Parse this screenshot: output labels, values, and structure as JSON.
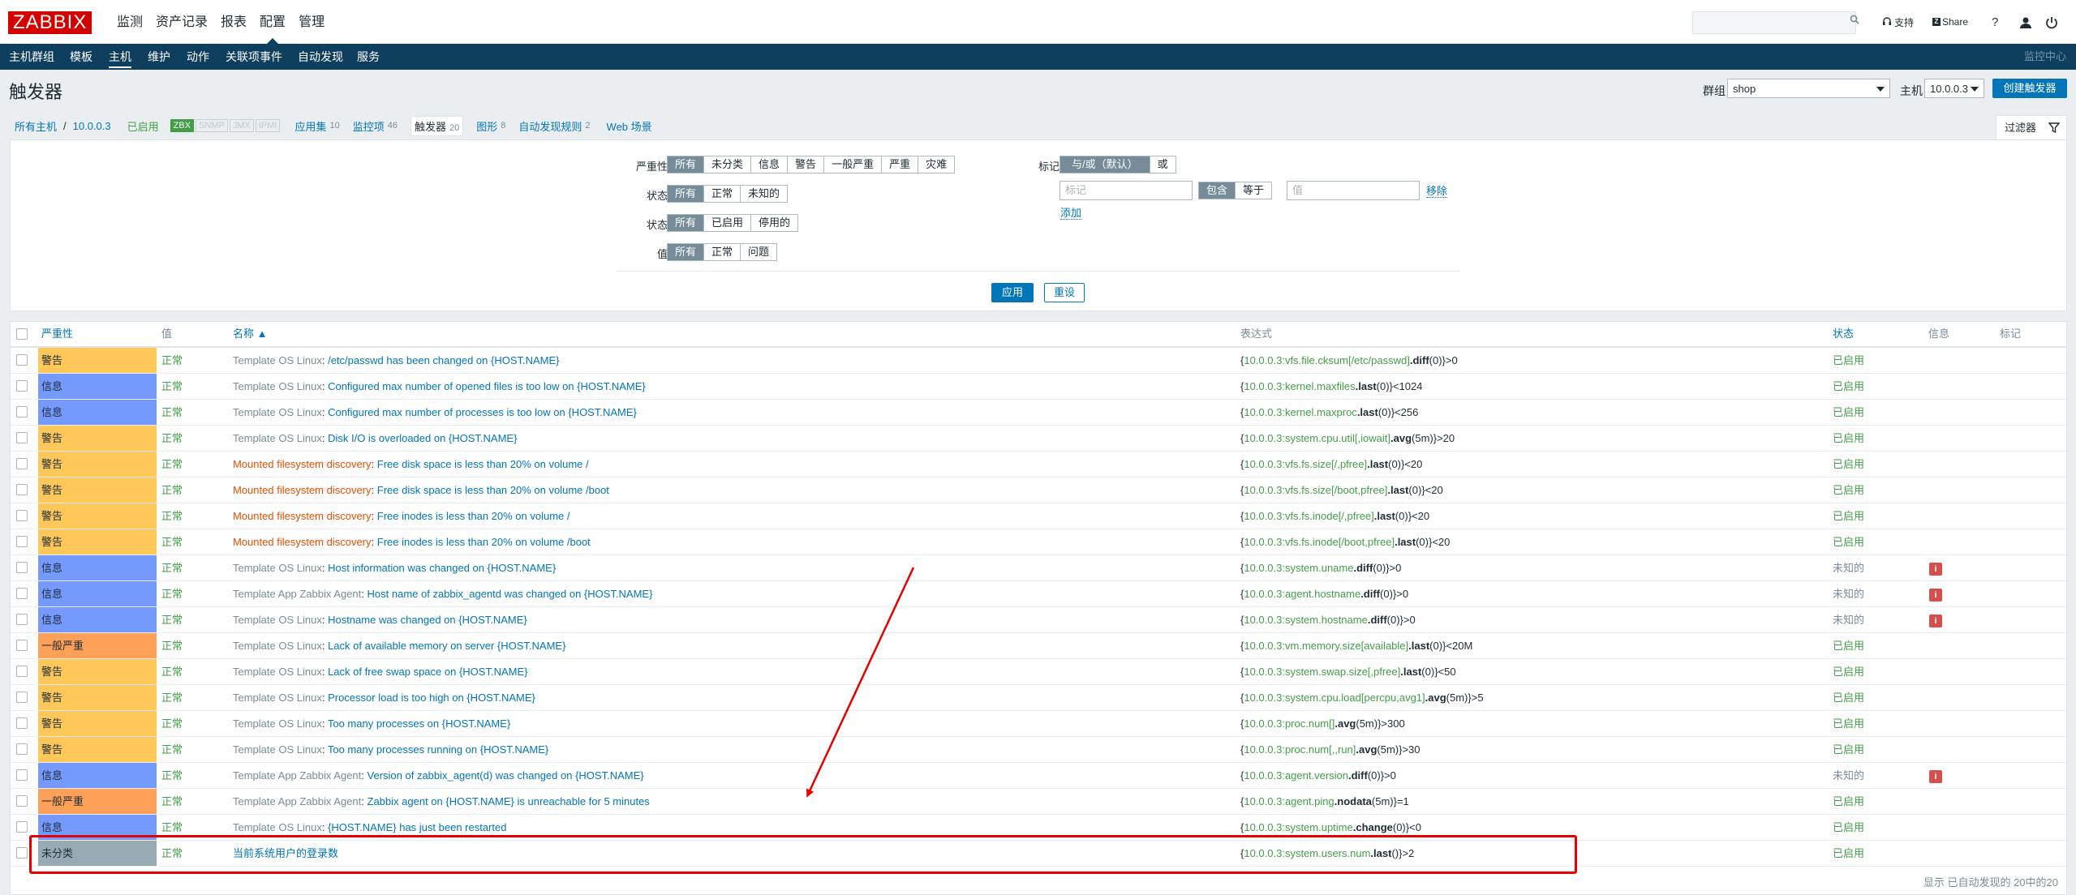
{
  "app": {
    "logo": "ZABBIX",
    "main_menu": [
      "监测",
      "资产记录",
      "报表",
      "配置",
      "管理"
    ],
    "active_main": "配置",
    "support": "支持",
    "share": "Share",
    "help": "?",
    "sub_menu": [
      "主机群组",
      "模板",
      "主机",
      "维护",
      "动作",
      "关联项事件",
      "自动发现",
      "服务"
    ],
    "active_sub": "主机",
    "monitor_center": "监控中心"
  },
  "header": {
    "title": "触发器",
    "group_label": "群组",
    "group_value": "shop",
    "host_label": "主机",
    "host_value": "10.0.0.3",
    "create_button": "创建触发器"
  },
  "crumbs": {
    "all_hosts": "所有主机",
    "slash": "/",
    "host": "10.0.0.3",
    "enabled": "已启用",
    "badges": [
      "ZBX",
      "SNMP",
      "JMX",
      "IPMI"
    ],
    "apps": "应用集",
    "apps_count": "10",
    "items": "监控项",
    "items_count": "46",
    "triggers": "触发器",
    "triggers_count": "20",
    "graphs": "图形",
    "graphs_count": "8",
    "discovery": "自动发现规则",
    "discovery_count": "2",
    "web": "Web 场景"
  },
  "filter": {
    "tab_label": "过滤器",
    "severity_label": "严重性",
    "severity_options": [
      "所有",
      "未分类",
      "信息",
      "警告",
      "一般严重",
      "严重",
      "灾难"
    ],
    "state_label": "状态",
    "state_options": [
      "所有",
      "正常",
      "未知的"
    ],
    "status_label": "状态",
    "status_options": [
      "所有",
      "已启用",
      "停用的"
    ],
    "value_label": "值",
    "value_options": [
      "所有",
      "正常",
      "问题"
    ],
    "tags_label": "标记",
    "tag_mode_options": [
      "与/或（默认）",
      "或"
    ],
    "tag_placeholder": "标记",
    "tag_op_options": [
      "包含",
      "等于"
    ],
    "value_placeholder": "值",
    "remove": "移除",
    "add": "添加",
    "apply": "应用",
    "reset": "重设"
  },
  "table": {
    "headers": {
      "severity": "严重性",
      "value": "值",
      "name": "名称 ▲",
      "expression": "表达式",
      "status": "状态",
      "info": "信息",
      "tags": "标记"
    },
    "rows": [
      {
        "severity": "警告",
        "sev_color": "#ffc859",
        "value": "正常",
        "prefix": "Template OS Linux",
        "prefix_type": "tpl",
        "name": "/etc/passwd has been changed on {HOST.NAME}",
        "e1": "{",
        "ekey": "10.0.0.3:vfs.file.cksum[/etc/passwd]",
        "efn": ".diff",
        "eargs": "(0)",
        "erest": "}>0",
        "status": "已启用",
        "status_type": "en",
        "info": false
      },
      {
        "severity": "信息",
        "sev_color": "#7499ff",
        "value": "正常",
        "prefix": "Template OS Linux",
        "prefix_type": "tpl",
        "name": "Configured max number of opened files is too low on {HOST.NAME}",
        "e1": "{",
        "ekey": "10.0.0.3:kernel.maxfiles",
        "efn": ".last",
        "eargs": "(0)",
        "erest": "}<1024",
        "status": "已启用",
        "status_type": "en",
        "info": false
      },
      {
        "severity": "信息",
        "sev_color": "#7499ff",
        "value": "正常",
        "prefix": "Template OS Linux",
        "prefix_type": "tpl",
        "name": "Configured max number of processes is too low on {HOST.NAME}",
        "e1": "{",
        "ekey": "10.0.0.3:kernel.maxproc",
        "efn": ".last",
        "eargs": "(0)",
        "erest": "}<256",
        "status": "已启用",
        "status_type": "en",
        "info": false
      },
      {
        "severity": "警告",
        "sev_color": "#ffc859",
        "value": "正常",
        "prefix": "Template OS Linux",
        "prefix_type": "tpl",
        "name": "Disk I/O is overloaded on {HOST.NAME}",
        "e1": "{",
        "ekey": "10.0.0.3:system.cpu.util[,iowait]",
        "efn": ".avg",
        "eargs": "(5m)",
        "erest": "}>20",
        "status": "已启用",
        "status_type": "en",
        "info": false
      },
      {
        "severity": "警告",
        "sev_color": "#ffc859",
        "value": "正常",
        "prefix": "Mounted filesystem discovery",
        "prefix_type": "disc",
        "name": "Free disk space is less than 20% on volume /",
        "e1": "{",
        "ekey": "10.0.0.3:vfs.fs.size[/,pfree]",
        "efn": ".last",
        "eargs": "(0)",
        "erest": "}<20",
        "status": "已启用",
        "status_type": "en",
        "info": false
      },
      {
        "severity": "警告",
        "sev_color": "#ffc859",
        "value": "正常",
        "prefix": "Mounted filesystem discovery",
        "prefix_type": "disc",
        "name": "Free disk space is less than 20% on volume /boot",
        "e1": "{",
        "ekey": "10.0.0.3:vfs.fs.size[/boot,pfree]",
        "efn": ".last",
        "eargs": "(0)",
        "erest": "}<20",
        "status": "已启用",
        "status_type": "en",
        "info": false
      },
      {
        "severity": "警告",
        "sev_color": "#ffc859",
        "value": "正常",
        "prefix": "Mounted filesystem discovery",
        "prefix_type": "disc",
        "name": "Free inodes is less than 20% on volume /",
        "e1": "{",
        "ekey": "10.0.0.3:vfs.fs.inode[/,pfree]",
        "efn": ".last",
        "eargs": "(0)",
        "erest": "}<20",
        "status": "已启用",
        "status_type": "en",
        "info": false
      },
      {
        "severity": "警告",
        "sev_color": "#ffc859",
        "value": "正常",
        "prefix": "Mounted filesystem discovery",
        "prefix_type": "disc",
        "name": "Free inodes is less than 20% on volume /boot",
        "e1": "{",
        "ekey": "10.0.0.3:vfs.fs.inode[/boot,pfree]",
        "efn": ".last",
        "eargs": "(0)",
        "erest": "}<20",
        "status": "已启用",
        "status_type": "en",
        "info": false
      },
      {
        "severity": "信息",
        "sev_color": "#7499ff",
        "value": "正常",
        "prefix": "Template OS Linux",
        "prefix_type": "tpl",
        "name": "Host information was changed on {HOST.NAME}",
        "e1": "{",
        "ekey": "10.0.0.3:system.uname",
        "efn": ".diff",
        "eargs": "(0)",
        "erest": "}>0",
        "status": "未知的",
        "status_type": "un",
        "info": true
      },
      {
        "severity": "信息",
        "sev_color": "#7499ff",
        "value": "正常",
        "prefix": "Template App Zabbix Agent",
        "prefix_type": "tpl",
        "name": "Host name of zabbix_agentd was changed on {HOST.NAME}",
        "e1": "{",
        "ekey": "10.0.0.3:agent.hostname",
        "efn": ".diff",
        "eargs": "(0)",
        "erest": "}>0",
        "status": "未知的",
        "status_type": "un",
        "info": true
      },
      {
        "severity": "信息",
        "sev_color": "#7499ff",
        "value": "正常",
        "prefix": "Template OS Linux",
        "prefix_type": "tpl",
        "name": "Hostname was changed on {HOST.NAME}",
        "e1": "{",
        "ekey": "10.0.0.3:system.hostname",
        "efn": ".diff",
        "eargs": "(0)",
        "erest": "}>0",
        "status": "未知的",
        "status_type": "un",
        "info": true
      },
      {
        "severity": "一般严重",
        "sev_color": "#ffa059",
        "value": "正常",
        "prefix": "Template OS Linux",
        "prefix_type": "tpl",
        "name": "Lack of available memory on server {HOST.NAME}",
        "e1": "{",
        "ekey": "10.0.0.3:vm.memory.size[available]",
        "efn": ".last",
        "eargs": "(0)",
        "erest": "}<20M",
        "status": "已启用",
        "status_type": "en",
        "info": false
      },
      {
        "severity": "警告",
        "sev_color": "#ffc859",
        "value": "正常",
        "prefix": "Template OS Linux",
        "prefix_type": "tpl",
        "name": "Lack of free swap space on {HOST.NAME}",
        "e1": "{",
        "ekey": "10.0.0.3:system.swap.size[,pfree]",
        "efn": ".last",
        "eargs": "(0)",
        "erest": "}<50",
        "status": "已启用",
        "status_type": "en",
        "info": false
      },
      {
        "severity": "警告",
        "sev_color": "#ffc859",
        "value": "正常",
        "prefix": "Template OS Linux",
        "prefix_type": "tpl",
        "name": "Processor load is too high on {HOST.NAME}",
        "e1": "{",
        "ekey": "10.0.0.3:system.cpu.load[percpu,avg1]",
        "efn": ".avg",
        "eargs": "(5m)",
        "erest": "}>5",
        "status": "已启用",
        "status_type": "en",
        "info": false
      },
      {
        "severity": "警告",
        "sev_color": "#ffc859",
        "value": "正常",
        "prefix": "Template OS Linux",
        "prefix_type": "tpl",
        "name": "Too many processes on {HOST.NAME}",
        "e1": "{",
        "ekey": "10.0.0.3:proc.num[]",
        "efn": ".avg",
        "eargs": "(5m)",
        "erest": "}>300",
        "status": "已启用",
        "status_type": "en",
        "info": false
      },
      {
        "severity": "警告",
        "sev_color": "#ffc859",
        "value": "正常",
        "prefix": "Template OS Linux",
        "prefix_type": "tpl",
        "name": "Too many processes running on {HOST.NAME}",
        "e1": "{",
        "ekey": "10.0.0.3:proc.num[,,run]",
        "efn": ".avg",
        "eargs": "(5m)",
        "erest": "}>30",
        "status": "已启用",
        "status_type": "en",
        "info": false
      },
      {
        "severity": "信息",
        "sev_color": "#7499ff",
        "value": "正常",
        "prefix": "Template App Zabbix Agent",
        "prefix_type": "tpl",
        "name": "Version of zabbix_agent(d) was changed on {HOST.NAME}",
        "e1": "{",
        "ekey": "10.0.0.3:agent.version",
        "efn": ".diff",
        "eargs": "(0)",
        "erest": "}>0",
        "status": "未知的",
        "status_type": "un",
        "info": true
      },
      {
        "severity": "一般严重",
        "sev_color": "#ffa059",
        "value": "正常",
        "prefix": "Template App Zabbix Agent",
        "prefix_type": "tpl",
        "name": "Zabbix agent on {HOST.NAME} is unreachable for 5 minutes",
        "e1": "{",
        "ekey": "10.0.0.3:agent.ping",
        "efn": ".nodata",
        "eargs": "(5m)",
        "erest": "}=1",
        "status": "已启用",
        "status_type": "en",
        "info": false
      },
      {
        "severity": "信息",
        "sev_color": "#7499ff",
        "value": "正常",
        "prefix": "Template OS Linux",
        "prefix_type": "tpl",
        "name": "{HOST.NAME} has just been restarted",
        "e1": "{",
        "ekey": "10.0.0.3:system.uptime",
        "efn": ".change",
        "eargs": "(0)",
        "erest": "}<0",
        "status": "已启用",
        "status_type": "en",
        "info": false
      },
      {
        "severity": "未分类",
        "sev_color": "#97aab3",
        "value": "正常",
        "prefix": "",
        "prefix_type": "tpl",
        "name": "当前系统用户的登录数",
        "e1": "{",
        "ekey": "10.0.0.3:system.users.num",
        "efn": ".last",
        "eargs": "()",
        "erest": "}>2",
        "status": "已启用",
        "status_type": "en",
        "info": false
      }
    ],
    "info_glyph": "i",
    "footer": "显示 已自动发现的 20中的20"
  }
}
